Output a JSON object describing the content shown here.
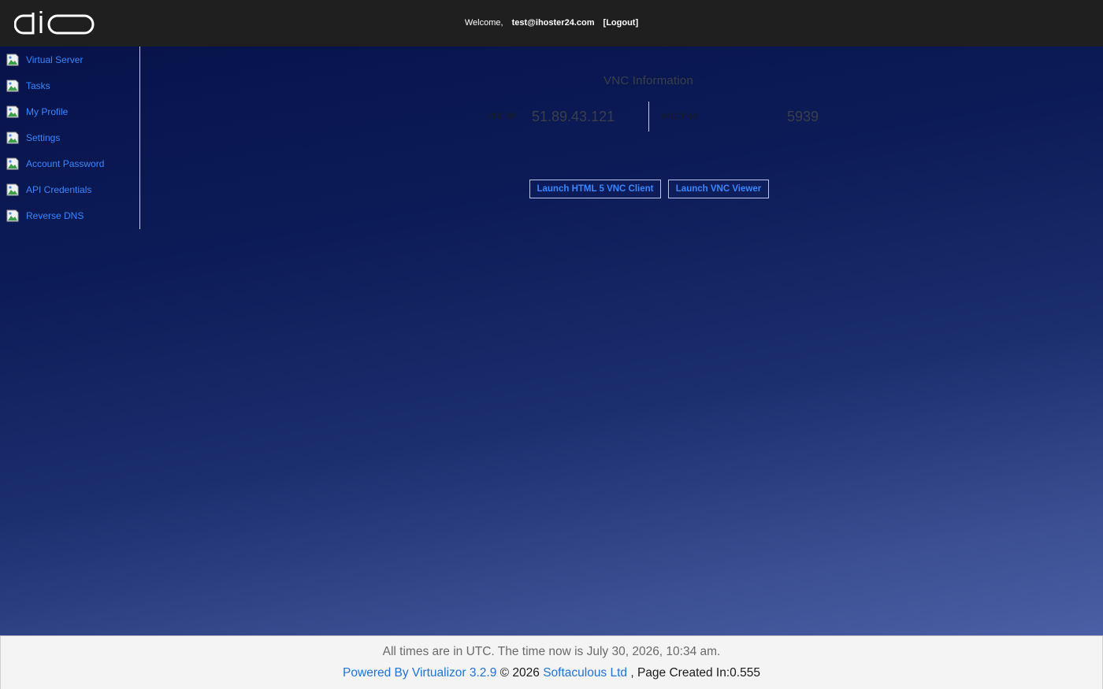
{
  "header": {
    "logo_text": "dio",
    "welcome_label": "Welcome,",
    "user_email": "test@ihoster24.com",
    "logout_label": "[Logout]"
  },
  "sidebar": {
    "items": [
      {
        "label": "Virtual Server",
        "icon": "broken-image-icon"
      },
      {
        "label": "Tasks",
        "icon": "broken-image-icon"
      },
      {
        "label": "My Profile",
        "icon": "broken-image-icon"
      },
      {
        "label": "Settings",
        "icon": "broken-image-icon"
      },
      {
        "label": "Account Password",
        "icon": "broken-image-icon"
      },
      {
        "label": "API Credentials",
        "icon": "broken-image-icon"
      },
      {
        "label": "Reverse DNS",
        "icon": "broken-image-icon"
      }
    ]
  },
  "vnc": {
    "title": "VNC Information",
    "ip_label": "VNC IP",
    "ip_value": "51.89.43.121",
    "port_label": "VNC Port",
    "port_value": "5939",
    "html5_button": "Launch HTML 5 VNC Client",
    "viewer_button": "Launch VNC Viewer"
  },
  "footer": {
    "time_text": "All times are in UTC. The time now is July 30, 2026, 10:34 am.",
    "powered_by": "Powered By Virtualizor 3.2.9",
    "copyright": "© 2026",
    "company": "Softaculous Ltd",
    "page_created": ", Page Created In:0.555"
  },
  "colors": {
    "header_bg": "#1f1f1f",
    "link_blue": "#3a87ff",
    "footer_bg": "#f4f4f4"
  }
}
